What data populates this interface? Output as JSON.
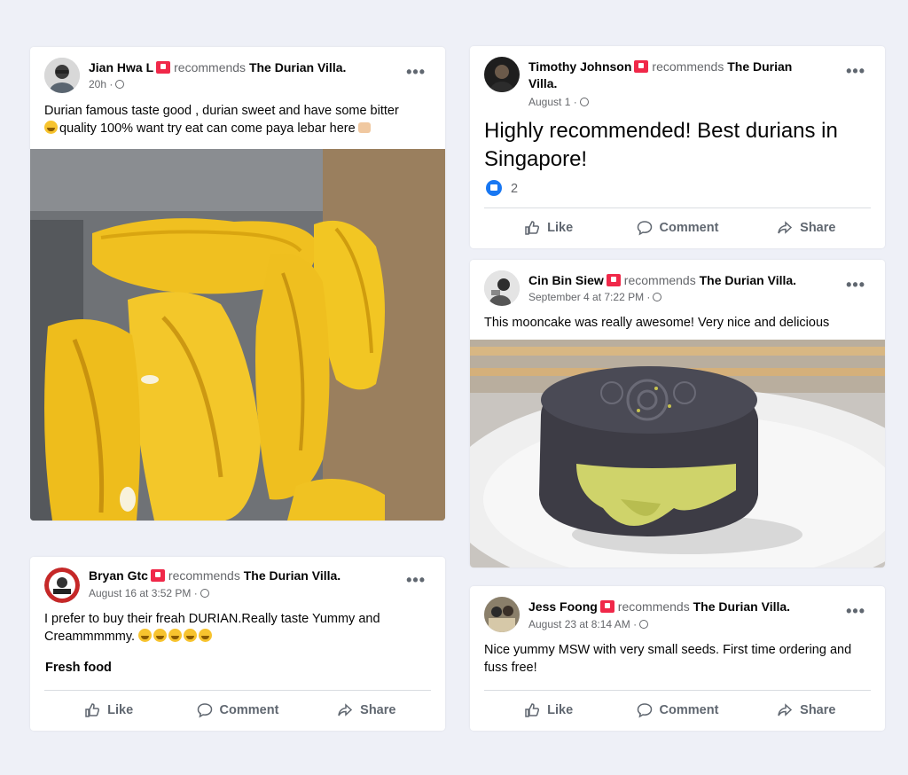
{
  "common": {
    "recommends": "recommends",
    "page_name": "The Durian Villa.",
    "more": "•••",
    "like": "Like",
    "comment": "Comment",
    "share": "Share"
  },
  "posts": [
    {
      "author": "Jian Hwa L",
      "time": "20h ·",
      "text": "Durian famous taste good , durian sweet and have some bitter",
      "text2": "quality 100% want try eat can come paya lebar here"
    },
    {
      "author": "Timothy Johnson",
      "page_line1": "The Durian",
      "page_line2": "Villa.",
      "time": "August 1 ·",
      "text": "Highly recommended! Best durians in Singapore!",
      "like_count": "2"
    },
    {
      "author": "Cin Bin Siew",
      "time": "September 4 at 7:22 PM ·",
      "text": "This mooncake was really awesome! Very nice and delicious"
    },
    {
      "author": "Bryan Gtc",
      "time": "August 16 at 3:52 PM ·",
      "text": "I prefer to buy their freah DURIAN.Really taste Yummy and",
      "text2": "Creammmmmy.",
      "tag": "Fresh food"
    },
    {
      "author": "Jess Foong",
      "time": "August 23 at 8:14 AM ·",
      "text": "Nice yummy MSW with very small seeds. First time ordering and fuss free!"
    }
  ]
}
